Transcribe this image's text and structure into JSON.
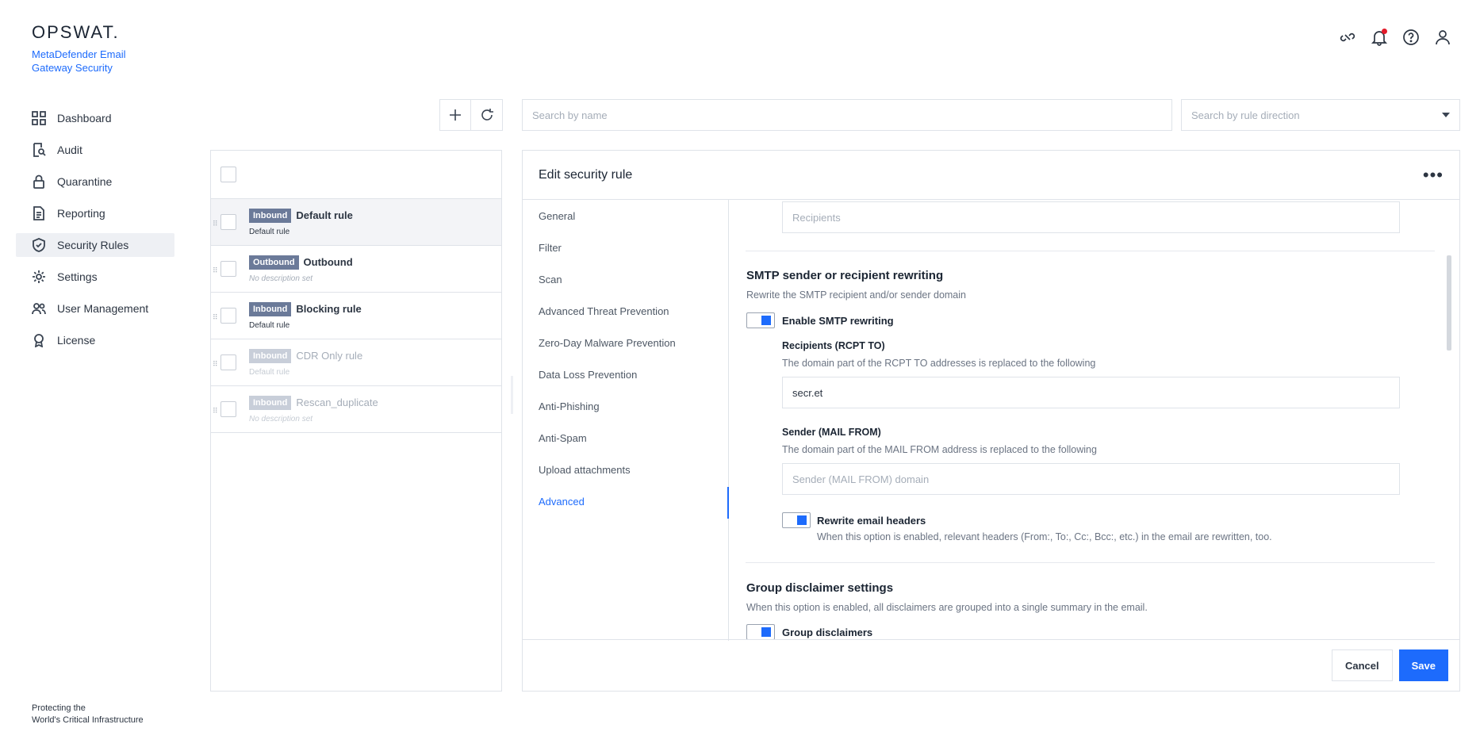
{
  "brand": {
    "logo": "OPSWAT.",
    "product": "MetaDefender Email Gateway Security",
    "footer_line1": "Protecting the",
    "footer_line2": "World's Critical Infrastructure"
  },
  "sidebar": {
    "items": [
      {
        "label": "Dashboard",
        "icon": "grid-icon"
      },
      {
        "label": "Audit",
        "icon": "audit-icon"
      },
      {
        "label": "Quarantine",
        "icon": "lock-icon"
      },
      {
        "label": "Reporting",
        "icon": "document-icon"
      },
      {
        "label": "Security Rules",
        "icon": "shield-check-icon",
        "active": true
      },
      {
        "label": "Settings",
        "icon": "gear-icon"
      },
      {
        "label": "User Management",
        "icon": "users-icon"
      },
      {
        "label": "License",
        "icon": "badge-icon"
      }
    ]
  },
  "header": {
    "icons": [
      "link-broken-icon",
      "bell-icon",
      "help-icon",
      "user-icon"
    ],
    "notification_dot_color": "#e21b2a"
  },
  "toolbar": {
    "search_placeholder": "Search by name",
    "direction_placeholder": "Search by rule direction"
  },
  "rules": [
    {
      "direction": "Inbound",
      "name": "Default rule",
      "description": "Default rule",
      "selected": true,
      "enabled": true
    },
    {
      "direction": "Outbound",
      "name": "Outbound",
      "description": "No description set",
      "enabled": true
    },
    {
      "direction": "Inbound",
      "name": "Blocking rule",
      "description": "Default rule",
      "enabled": true
    },
    {
      "direction": "Inbound",
      "name": "CDR Only rule",
      "description": "Default rule",
      "enabled": false
    },
    {
      "direction": "Inbound",
      "name": "Rescan_duplicate",
      "description": "No description set",
      "enabled": false
    }
  ],
  "edit": {
    "title": "Edit security rule",
    "sections": [
      "General",
      "Filter",
      "Scan",
      "Advanced Threat Prevention",
      "Zero-Day Malware Prevention",
      "Data Loss Prevention",
      "Anti-Phishing",
      "Anti-Spam",
      "Upload attachments",
      "Advanced"
    ],
    "active_section": "Advanced",
    "recipients_placeholder": "Recipients",
    "smtp": {
      "title": "SMTP sender or recipient rewriting",
      "desc": "Rewrite the SMTP recipient and/or sender domain",
      "toggle_label": "Enable SMTP rewriting",
      "rcpt_label": "Recipients (RCPT TO)",
      "rcpt_desc": "The domain part of the RCPT TO addresses is replaced to the following",
      "rcpt_value": "secr.et",
      "sender_label": "Sender (MAIL FROM)",
      "sender_desc": "The domain part of the MAIL FROM address is replaced to the following",
      "sender_placeholder": "Sender (MAIL FROM) domain",
      "headers_label": "Rewrite email headers",
      "headers_desc": "When this option is enabled, relevant headers (From:, To:, Cc:, Bcc:, etc.) in the email are rewritten, too."
    },
    "group": {
      "title": "Group disclaimer settings",
      "desc": "When this option is enabled, all disclaimers are grouped into a single summary in the email.",
      "toggle_label": "Group disclaimers"
    },
    "cancel_label": "Cancel",
    "save_label": "Save"
  },
  "colors": {
    "accent": "#1d6bfc",
    "badge": "#6b7a99"
  }
}
